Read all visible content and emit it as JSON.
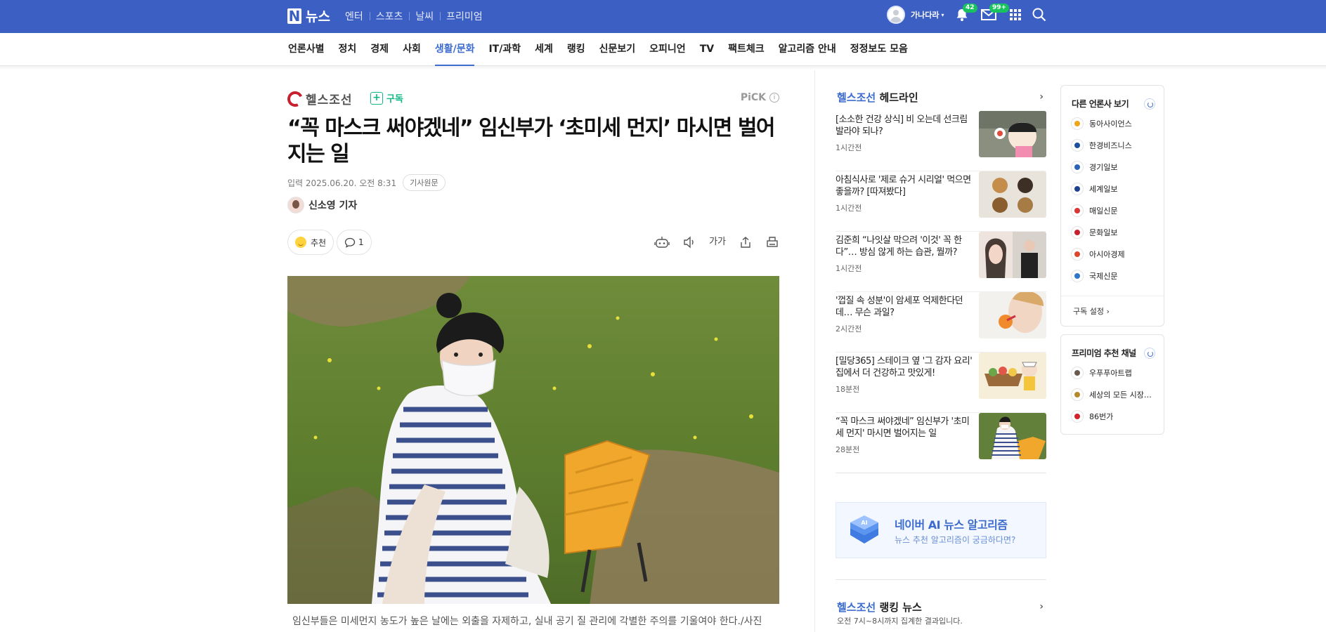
{
  "header": {
    "logo_letter": "N",
    "logo_text": "뉴스",
    "nav": [
      "엔터",
      "스포츠",
      "날씨",
      "프리미엄"
    ],
    "user_name": "가나다라",
    "notification_count": "42",
    "mail_count": "99+"
  },
  "categories": [
    "언론사별",
    "정치",
    "경제",
    "사회",
    "생활/문화",
    "IT/과학",
    "세계",
    "랭킹",
    "신문보기",
    "오피니언",
    "TV",
    "팩트체크",
    "알고리즘 안내",
    "정정보도 모음"
  ],
  "active_category": "생활/문화",
  "article": {
    "press_name": "헬스조선",
    "subscribe_label": "구독",
    "pick_label": "PiCK",
    "headline": "“꼭 마스크 써야겠네” 임신부가 ‘초미세 먼지’ 마시면 벌어지는 일",
    "date": "입력 2025.06.20. 오전 8:31",
    "original_button": "기사원문",
    "reporter": "신소영 기자",
    "recommend_label": "추천",
    "comment_count": "1",
    "font_size_label": "가가",
    "caption": "임신부들은 미세먼지 농도가 높은 날에는 외출을 자제하고, 실내 공기 질 관리에 각별한 주의를 기울여야 한다./사진"
  },
  "headlines": {
    "press": "헬스조선",
    "title": "헤드라인",
    "items": [
      {
        "text": "[소소한 건강 상식] 비 오는데 선크림 발라야 되나?",
        "time": "1시간전"
      },
      {
        "text": "아침식사로 '제로 슈거 시리얼' 먹으면 좋을까? [따져봤다]",
        "time": "1시간전"
      },
      {
        "text": "김준희 “나잇살 막으려 '이것' 꼭 한다”… 방심 않게 하는 습관, 뭘까?",
        "time": "1시간전"
      },
      {
        "text": "'껍질 속 성분'이 암세포 억제한다던데… 무슨 과일?",
        "time": "2시간전"
      },
      {
        "text": "[밀당365] 스테이크 옆 '그 감자 요리' 집에서 더 건강하고 맛있게!",
        "time": "18분전"
      },
      {
        "text": "“꼭 마스크 써야겠네” 임신부가 '초미세 먼지' 마시면 벌어지는 일",
        "time": "28분전"
      }
    ]
  },
  "ai_banner": {
    "title": "네이버 AI 뉴스 알고리즘",
    "subtitle": "뉴스 추천 알고리즘이 궁금하다면?",
    "cube_label": "AI"
  },
  "ranking": {
    "press": "헬스조선",
    "title": "랭킹 뉴스",
    "subtitle": "오전 7시~8시까지 집계한 결과입니다."
  },
  "other_press": {
    "title": "다른 언론사 보기",
    "items": [
      {
        "name": "동아사이언스",
        "color": "#f2a516"
      },
      {
        "name": "한경비즈니스",
        "color": "#1d4f9c"
      },
      {
        "name": "경기일보",
        "color": "#2a63b8"
      },
      {
        "name": "세계일보",
        "color": "#1f3f8f"
      },
      {
        "name": "매일신문",
        "color": "#d93636"
      },
      {
        "name": "문화일보",
        "color": "#c8202f"
      },
      {
        "name": "아시아경제",
        "color": "#e0452b"
      },
      {
        "name": "국제신문",
        "color": "#2d76c9"
      }
    ],
    "setting": "구독 설정"
  },
  "premium": {
    "title": "프리미엄 추천 채널",
    "items": [
      {
        "name": "우푸푸아트랩",
        "color": "#6b5a4e"
      },
      {
        "name": "세상의 모든 시장…",
        "color": "#b58a2b"
      },
      {
        "name": "86번가",
        "color": "#d6202a"
      }
    ]
  },
  "colors": {
    "brand_blue": "#3c5fc4",
    "accent_blue": "#3c6ccd",
    "subscribe_green": "#12b886",
    "badge_green": "#18c35f"
  }
}
